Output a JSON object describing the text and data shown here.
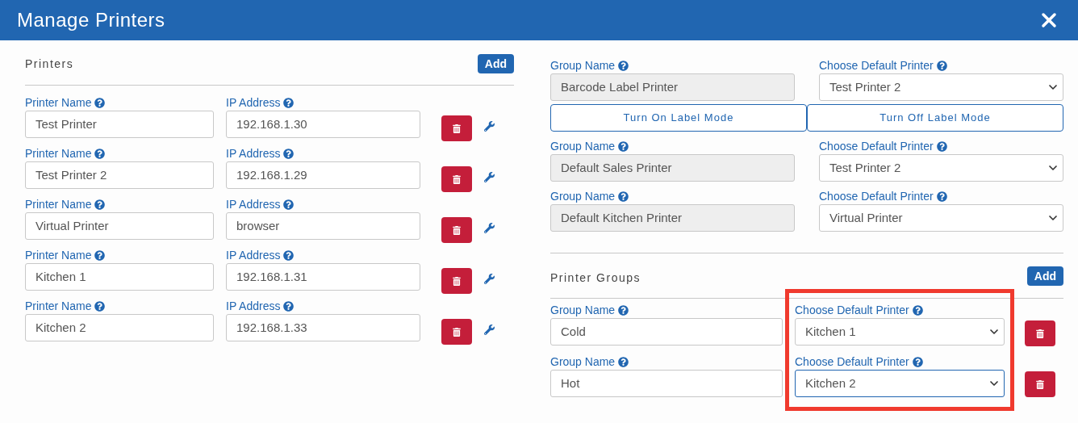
{
  "window": {
    "title": "Manage Printers"
  },
  "printers": {
    "title": "Printers",
    "add_label": "Add",
    "rows": [
      {
        "name_label": "Printer Name",
        "name": "Test Printer",
        "ip_label": "IP Address",
        "ip": "192.168.1.30"
      },
      {
        "name_label": "Printer Name",
        "name": "Test Printer 2",
        "ip_label": "IP Address",
        "ip": "192.168.1.29"
      },
      {
        "name_label": "Printer Name",
        "name": "Virtual Printer",
        "ip_label": "IP Address",
        "ip": "browser"
      },
      {
        "name_label": "Printer Name",
        "name": "Kitchen 1",
        "ip_label": "IP Address",
        "ip": "192.168.1.31"
      },
      {
        "name_label": "Printer Name",
        "name": "Kitchen 2",
        "ip_label": "IP Address",
        "ip": "192.168.1.33"
      }
    ]
  },
  "default_groups": [
    {
      "label": "Group Name",
      "name": "Barcode Label Printer",
      "printer_label": "Choose Default Printer",
      "printer": "Test Printer 2",
      "label_mode_buttons": [
        "Turn On Label Mode",
        "Turn Off Label Mode"
      ]
    },
    {
      "label": "Group Name",
      "name": "Default Sales Printer",
      "printer_label": "Choose Default Printer",
      "printer": "Test Printer 2"
    },
    {
      "label": "Group Name",
      "name": "Default Kitchen Printer",
      "printer_label": "Choose Default Printer",
      "printer": "Virtual Printer"
    }
  ],
  "printer_groups": {
    "title": "Printer Groups",
    "add_label": "Add",
    "highlighted": true,
    "rows": [
      {
        "name_label": "Group Name",
        "name": "Cold",
        "printer_label": "Choose Default Printer",
        "printer": "Kitchen 1",
        "focused": false
      },
      {
        "name_label": "Group Name",
        "name": "Hot",
        "printer_label": "Choose Default Printer",
        "printer": "Kitchen 2",
        "focused": true
      }
    ]
  }
}
